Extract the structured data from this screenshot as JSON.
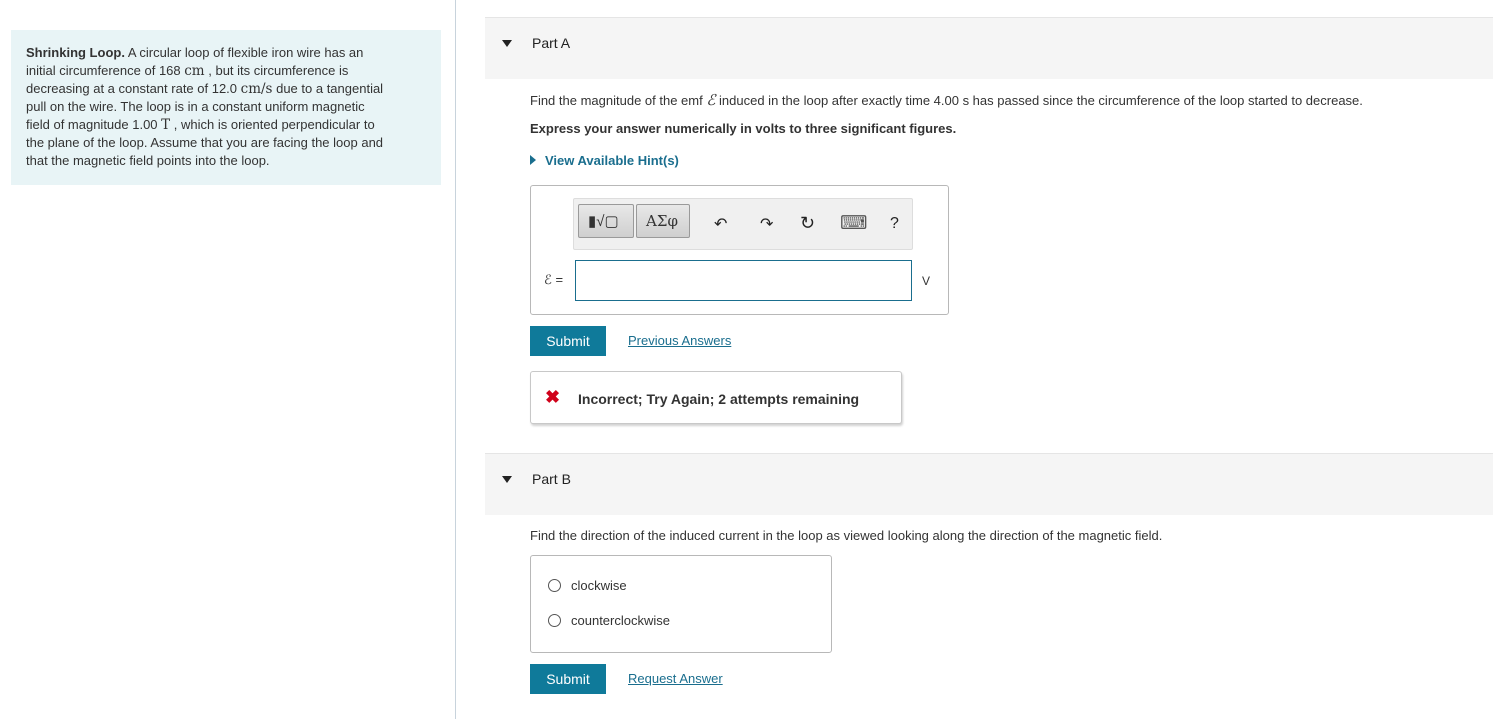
{
  "problem": {
    "title": "Shrinking Loop.",
    "line1_after_title": " A circular loop of flexible iron wire has an",
    "line2_a": "initial circumference of 168 ",
    "line2_unit": "cm",
    "line2_b": " , but its circumference is",
    "line3_a": "decreasing at a constant rate of 12.0 ",
    "line3_unit": "cm/s",
    "line3_b": " due to a tangential",
    "line4": "pull on the wire. The loop is in a constant uniform magnetic",
    "line5_a": "field of magnitude 1.00 ",
    "line5_unit": "T",
    "line5_b": " , which is oriented perpendicular to",
    "line6": "the plane of the loop. Assume that you are facing the loop and",
    "line7": "that the magnetic field points into the loop."
  },
  "part_a": {
    "title": "Part A",
    "question_a": "Find the magnitude of the emf ",
    "emf_symbol": "ℰ",
    "question_b": " induced in the loop after exactly time 4.00 s has passed since the circumference of the loop started to decrease.",
    "instruction": "Express your answer numerically in volts to three significant figures.",
    "hint_label": "View Available Hint(s)",
    "toolbar": {
      "template_button": "▮√▢",
      "greek_button": "ΑΣφ",
      "undo_icon": "↶",
      "redo_icon": "↷",
      "reset_icon": "↻",
      "keyboard_icon": "⌨",
      "help_icon": "?"
    },
    "answer_label": "ℰ =",
    "answer_value": "",
    "unit": "V",
    "submit_label": "Submit",
    "previous_answers_label": "Previous Answers",
    "feedback_icon": "✖",
    "feedback_text": "Incorrect; Try Again; 2 attempts remaining"
  },
  "part_b": {
    "title": "Part B",
    "question": "Find the direction of the induced current in the loop as viewed looking along the direction of the magnetic field.",
    "options": [
      "clockwise",
      "counterclockwise"
    ],
    "submit_label": "Submit",
    "request_answer_label": "Request Answer"
  },
  "colors": {
    "problem_background": "#e8f4f6",
    "accent": "#0f7a9a",
    "link": "#1a6e8e",
    "error": "#d0021b"
  }
}
